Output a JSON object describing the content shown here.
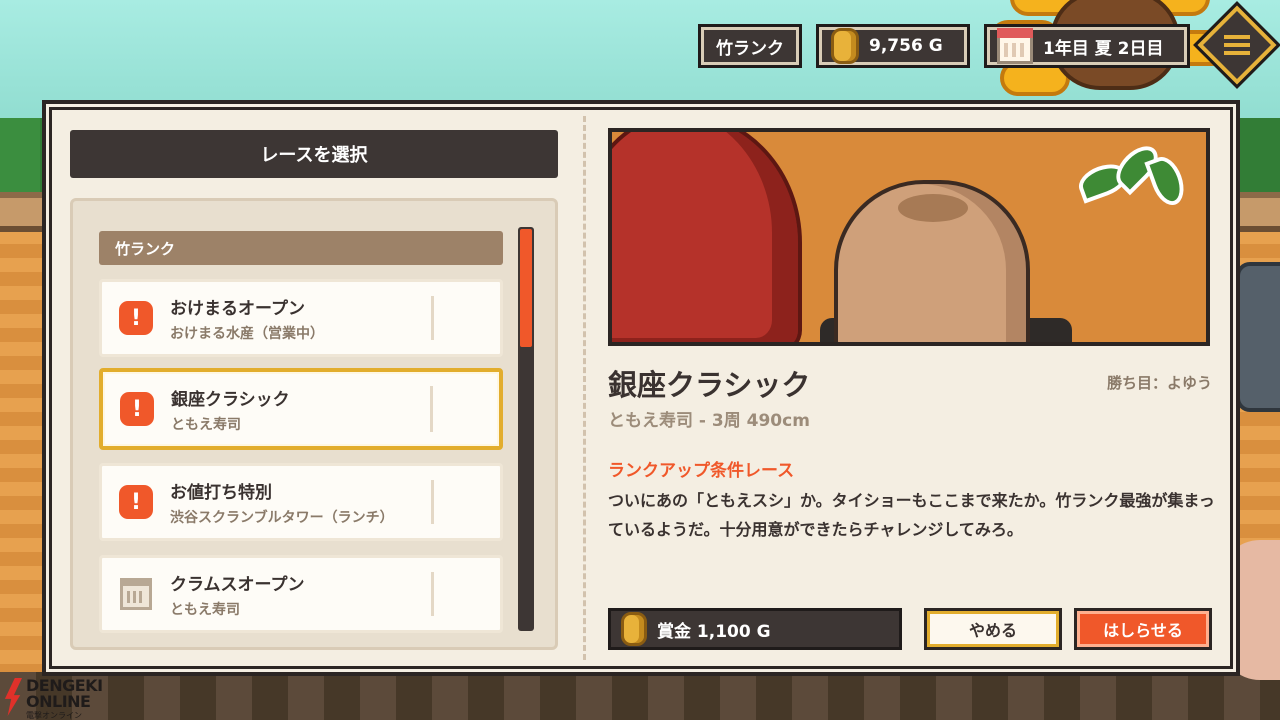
{
  "hud": {
    "rank": "竹ランク",
    "gold": "9,756 G",
    "date": "1年目 夏 2日目"
  },
  "race_select": {
    "title": "レースを選択",
    "rank_header": "竹ランク",
    "items": [
      {
        "name": "おけまるオープン",
        "sub": "おけまる水産（営業中）",
        "icon": "alert-icon"
      },
      {
        "name": "銀座クラシック",
        "sub": "ともえ寿司",
        "icon": "alert-icon",
        "selected": true
      },
      {
        "name": "お値打ち特別",
        "sub": "渋谷スクランブルタワー（ランチ）",
        "icon": "alert-icon"
      },
      {
        "name": "クラムスオープン",
        "sub": "ともえ寿司",
        "icon": "calendar-icon"
      }
    ]
  },
  "detail": {
    "title": "銀座クラシック",
    "win_condition": "勝ち目：よゆう",
    "subtitle": "ともえ寿司 - 3周 490cm",
    "condition_label": "ランクアップ条件レース",
    "description": "ついにあの「ともえスシ」か。タイショーもここまで来たか。竹ランク最強が集まっているようだ。十分用意ができたらチャレンジしてみろ。",
    "prize": "賞金 1,100 G",
    "cancel_label": "やめる",
    "run_label": "はしらせる"
  },
  "watermark": {
    "line1": "DENGEKI",
    "line2": "ONLINE",
    "line3": "電撃オンライン"
  },
  "colors": {
    "accent": "#f0582a",
    "selected_border": "#e2ad2d",
    "panel_dark": "#3d3634",
    "panel_bg": "#f4eee2"
  }
}
